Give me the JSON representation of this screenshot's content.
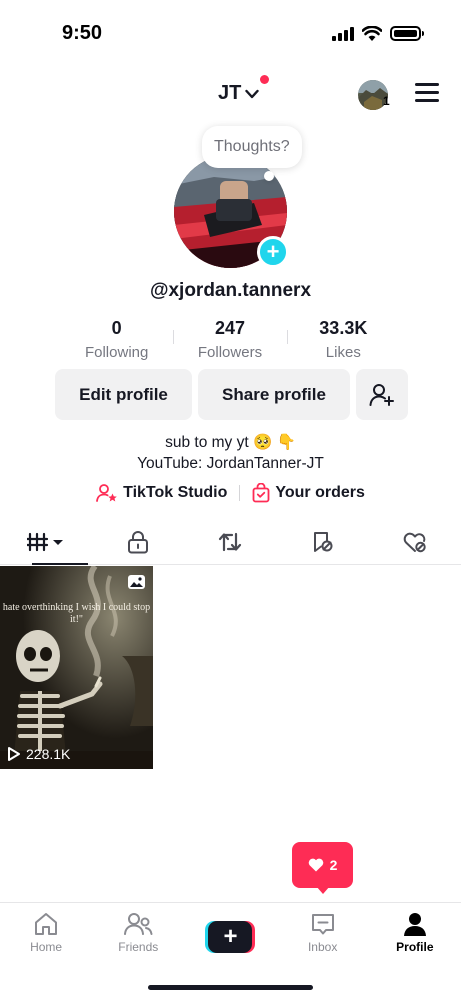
{
  "status_bar": {
    "time": "9:50"
  },
  "header": {
    "account_name": "JT",
    "notification_count_badge": "1",
    "menu_icon": "hamburger-icon"
  },
  "profile": {
    "thoughts_prompt": "Thoughts?",
    "username": "@xjordan.tannerx",
    "stats": {
      "following_count": "0",
      "following_label": "Following",
      "followers_count": "247",
      "followers_label": "Followers",
      "likes_count": "33.3K",
      "likes_label": "Likes"
    },
    "buttons": {
      "edit_profile": "Edit profile",
      "share_profile": "Share profile"
    },
    "bio_line1": "sub to my yt 🥺 👇",
    "bio_line2": "YouTube: JordanTanner-JT",
    "links": {
      "studio": "TikTok Studio",
      "orders": "Your orders"
    }
  },
  "tabs": [
    {
      "id": "videos",
      "icon": "grid-icon",
      "active": true
    },
    {
      "id": "private",
      "icon": "lock-icon",
      "active": false
    },
    {
      "id": "reposts",
      "icon": "repost-icon",
      "active": false
    },
    {
      "id": "favorites",
      "icon": "bookmark-icon",
      "active": false
    },
    {
      "id": "liked",
      "icon": "heart-icon",
      "active": false
    }
  ],
  "videos": [
    {
      "caption": "hate overthinking I wish I could stop it!\"",
      "views": "228.1K",
      "type": "photo"
    }
  ],
  "likes_popup": {
    "count": "2"
  },
  "bottom_nav": {
    "home": "Home",
    "friends": "Friends",
    "inbox": "Inbox",
    "profile": "Profile"
  },
  "colors": {
    "brand_red": "#fe2c55",
    "brand_cyan": "#20d5ec",
    "text_primary": "#161823",
    "text_secondary": "#757780",
    "button_bg": "#f1f1f2"
  }
}
